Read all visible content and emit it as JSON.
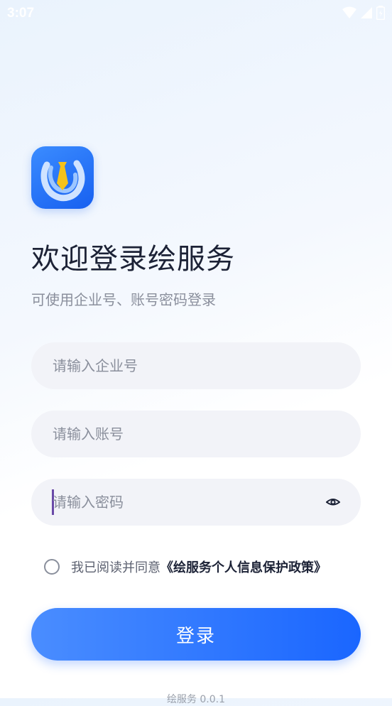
{
  "status_bar": {
    "time": "3:07",
    "icons": [
      "wifi-icon",
      "signal-icon",
      "battery-icon"
    ]
  },
  "logo": {
    "icon": "app-logo-icon",
    "accent": "#1f6bf5",
    "tie_color": "#f6c21a"
  },
  "welcome": {
    "title": "欢迎登录绘服务",
    "subtitle": "可使用企业号、账号密码登录"
  },
  "form": {
    "company": {
      "value": "",
      "placeholder": "请输入企业号"
    },
    "account": {
      "value": "",
      "placeholder": "请输入账号"
    },
    "password": {
      "value": "",
      "placeholder": "请输入密码",
      "toggle_icon": "eye-icon"
    }
  },
  "agreement": {
    "checked": false,
    "text": "我已阅读并同意",
    "link": "《绘服务个人信息保护政策》"
  },
  "login_button": {
    "label": "登录",
    "color": "#1a66ff"
  },
  "footer": {
    "version": "绘服务 0.0.1"
  }
}
